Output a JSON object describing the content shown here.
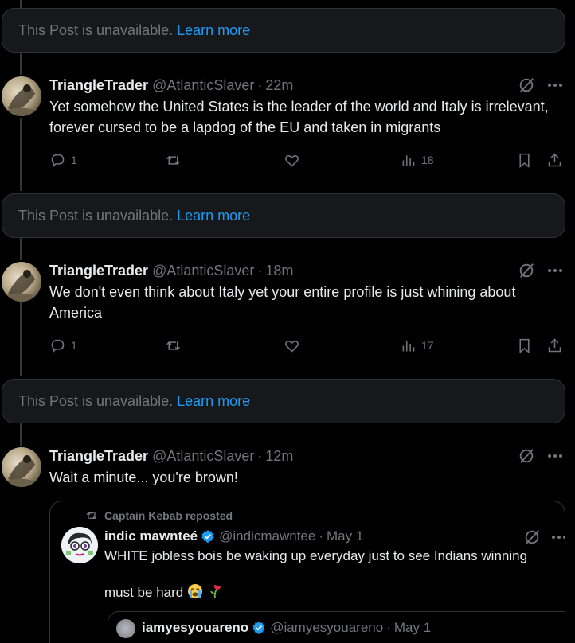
{
  "unavailable_notice": {
    "text": "This Post is unavailable.",
    "link": "Learn more"
  },
  "posts": [
    {
      "name": "TriangleTrader",
      "handle": "@AtlanticSlaver",
      "sep": "·",
      "time": "22m",
      "text": "Yet somehow the United States is the leader of the world and Italy is irrelevant, forever cursed to be a lapdog of the EU and taken in migrants",
      "replies": "1",
      "views": "18"
    },
    {
      "name": "TriangleTrader",
      "handle": "@AtlanticSlaver",
      "sep": "·",
      "time": "18m",
      "text": "We don't even think about Italy yet your entire profile is just whining about America",
      "replies": "1",
      "views": "17"
    },
    {
      "name": "TriangleTrader",
      "handle": "@AtlanticSlaver",
      "sep": "·",
      "time": "12m",
      "text": "Wait a minute... you're brown!"
    }
  ],
  "quote": {
    "repost_label": "Captain Kebab reposted",
    "name": "indic mawnteé",
    "handle": "@indicmawntee",
    "sep": "·",
    "time": "May 1",
    "line1": "WHITE jobless bois be waking up everyday just to see Indians winning",
    "line2": "must be hard",
    "inner": {
      "name": "iamyesyouareno",
      "handle": "@iamyesyouareno",
      "sep": "·",
      "time": "May 1"
    }
  },
  "icons": {
    "grok": "grok-icon",
    "more": "more-icon",
    "reply": "reply-icon",
    "repost": "repost-icon",
    "like": "like-icon",
    "views": "views-icon",
    "bookmark": "bookmark-icon",
    "share": "share-icon",
    "verified": "verified-badge-icon"
  },
  "colors": {
    "background": "#000000",
    "card": "#16181c",
    "border": "#2f3336",
    "link": "#1d9bf0",
    "muted": "#71767b",
    "text": "#e7e9ea"
  }
}
